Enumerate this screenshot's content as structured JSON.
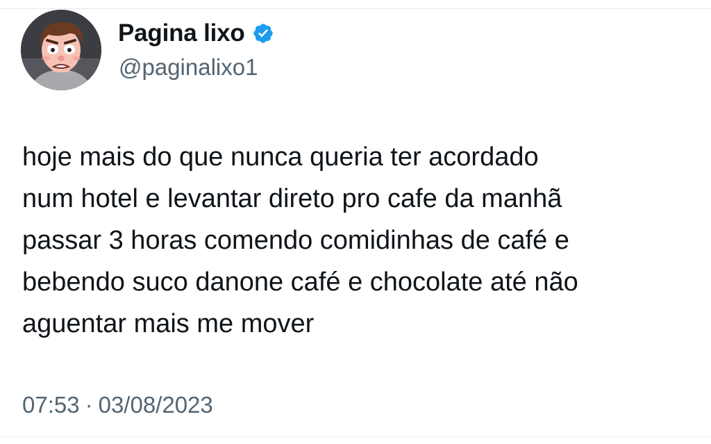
{
  "author": {
    "display_name": "Pagina lixo",
    "handle": "@paginalixo1",
    "verified_icon": "verified-badge-icon",
    "accent_color": "#1d9bf0"
  },
  "tweet": {
    "lines": [
      "hoje mais do que nunca queria ter acordado",
      "num hotel e levantar direto pro cafe da manhã",
      "passar 3 horas comendo comidinhas de café e",
      "bebendo suco danone café e chocolate até não",
      "aguentar mais me mover"
    ],
    "time": "07:53",
    "separator": "·",
    "date": "03/08/2023"
  },
  "colors": {
    "text": "#0f1419",
    "secondary": "#536471"
  }
}
